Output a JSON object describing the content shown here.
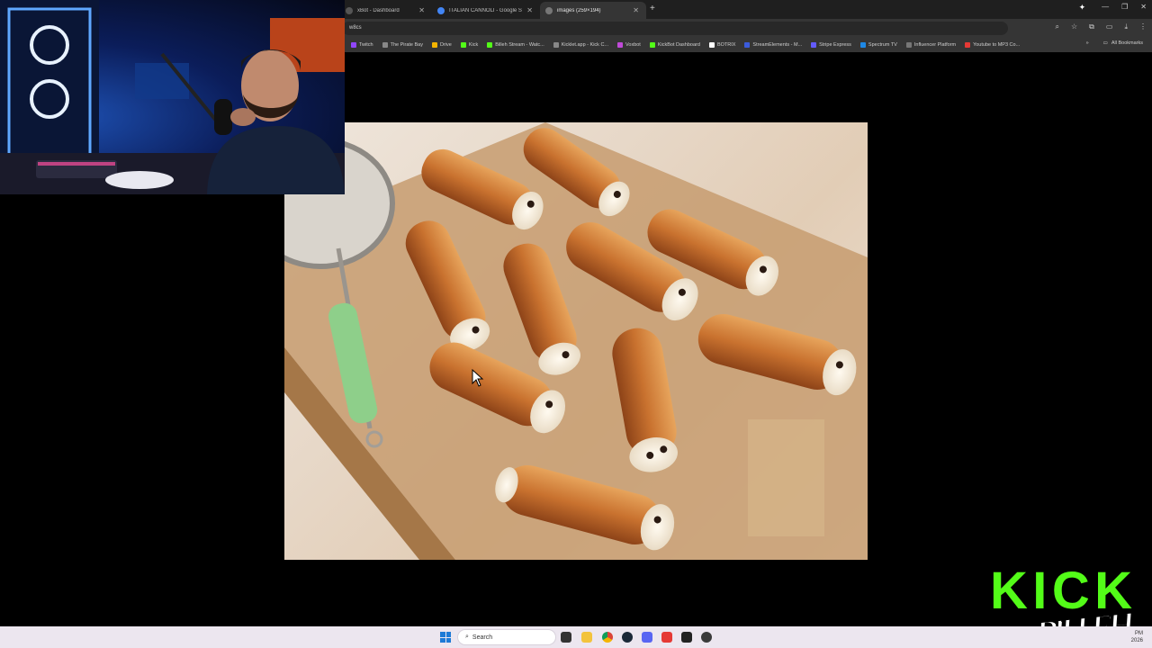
{
  "browser": {
    "tabs": [
      {
        "label": "xBot - Dashboard",
        "active": false
      },
      {
        "label": "ITALIAN CANNOLI - Google Se",
        "active": false
      },
      {
        "label": "images (259×194)",
        "active": true
      }
    ],
    "address": "w8cs",
    "bookmarks": [
      "Twitch",
      "The Pirate Bay",
      "Drive",
      "Kick",
      "Billeh Stream - Watc...",
      "Kicklet.app - Kick C...",
      "Voxbot",
      "KickBot Dashboard",
      "BOTRIX",
      "StreamElements - M...",
      "Stripe Express",
      "Spectrum TV",
      "Influencer Platform",
      "Youtube to MP3 Co..."
    ],
    "all_bookmarks": "All Bookmarks"
  },
  "overlay": {
    "logo_line1": "KICK",
    "logo_line2": "BILLEH"
  },
  "taskbar": {
    "search_placeholder": "Search",
    "clock": "PM",
    "date": "2026"
  },
  "colors": {
    "kick_green": "#53fc18",
    "chrome_dark": "#1f1f1f",
    "taskbar_bg": "#ece6ef"
  }
}
